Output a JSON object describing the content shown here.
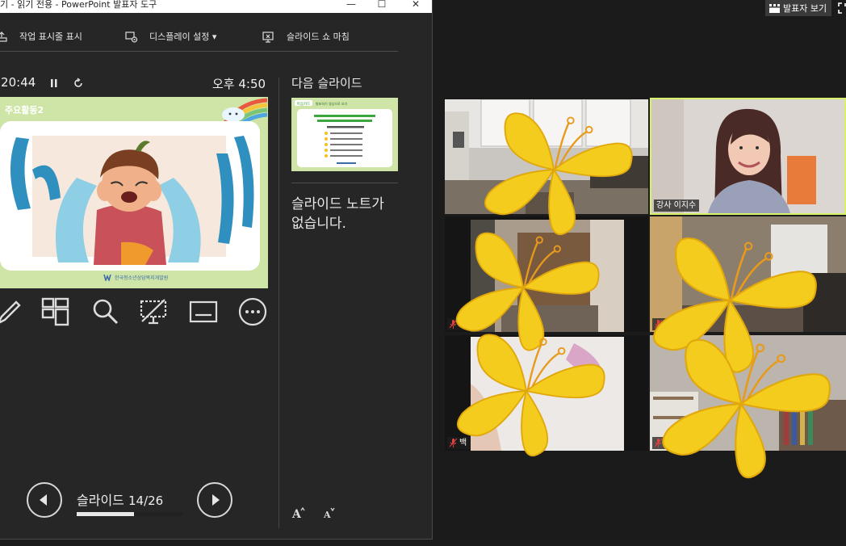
{
  "window": {
    "title": "기  -  읽기 전용 - PowerPoint 발표자 도구",
    "minimize": "—",
    "maximize": "☐",
    "close": "✕"
  },
  "toolbar": {
    "taskbar_label": "작업 표시줄 표시",
    "display_label": "디스플레이 설정 ▾",
    "end_show_label": "슬라이드 쇼 마침"
  },
  "presenter": {
    "timer": ":20:44",
    "clock": "오후 4:50",
    "next_slide_label": "다음 슬라이드",
    "notes_empty": "슬라이드 노트가 없습니다.",
    "slide_word": "슬라이드",
    "slide_counter": "14/26",
    "current_slide": 14,
    "total_slides": 26
  },
  "current_slide": {
    "tag": "주요활동2",
    "footer": "한국청소년상담복지개발원"
  },
  "next_slide": {
    "tag": "마음카드",
    "title_line": "발표하기 영상으로 보기"
  },
  "zoom": {
    "speaker_view": "발표자 보기",
    "participants": [
      {
        "name": ""
      },
      {
        "name": "강사 이지수"
      },
      {
        "name": "정"
      },
      {
        "name": ""
      },
      {
        "name": "백"
      },
      {
        "name": "김"
      }
    ]
  },
  "colors": {
    "slide_bg": "#cfe5a8",
    "active_speaker": "#d8f06a",
    "butterfly": "#f4cc1d"
  }
}
